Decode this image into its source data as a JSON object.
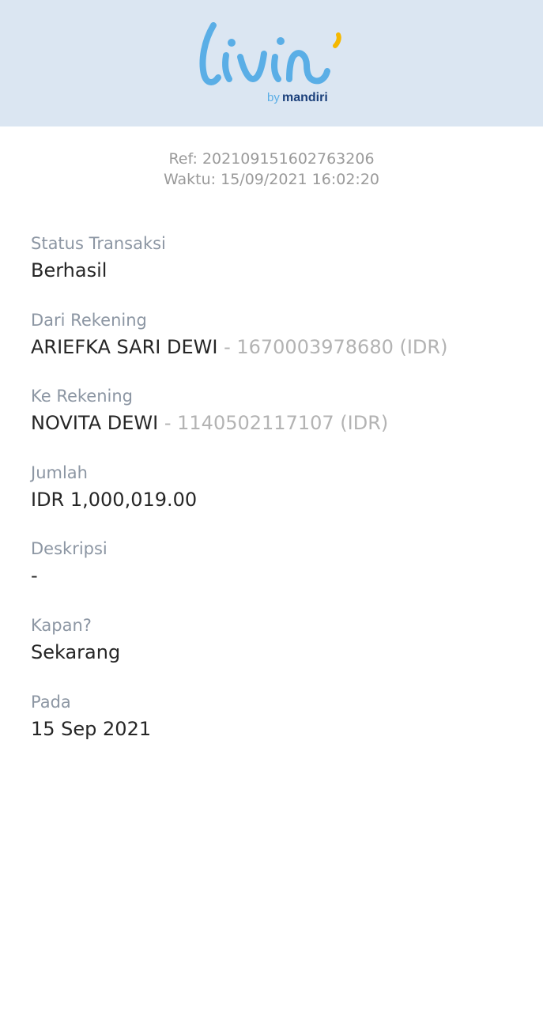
{
  "header": {
    "brand": "livin'",
    "by_text": "by",
    "sub_brand": "mandiri"
  },
  "receipt": {
    "ref": "Ref: 202109151602763206",
    "time": "Waktu: 15/09/2021 16:02:20"
  },
  "fields": {
    "status": {
      "label": "Status Transaksi",
      "value": "Berhasil"
    },
    "from": {
      "label": "Dari Rekening",
      "name": "ARIEFKA SARI DEWI",
      "account": " - 1670003978680 (IDR)"
    },
    "to": {
      "label": "Ke Rekening",
      "name": "NOVITA DEWI",
      "account": " - 1140502117107 (IDR)"
    },
    "amount": {
      "label": "Jumlah",
      "value": "IDR 1,000,019.00"
    },
    "description": {
      "label": "Deskripsi",
      "value": "-"
    },
    "when": {
      "label": "Kapan?",
      "value": "Sekarang"
    },
    "date": {
      "label": "Pada",
      "value": "15 Sep 2021"
    }
  },
  "colors": {
    "header_bg": "#dbe6f2",
    "logo_blue": "#5aaee6",
    "logo_accent": "#f5b800",
    "mandiri_navy": "#1a3f7a"
  }
}
